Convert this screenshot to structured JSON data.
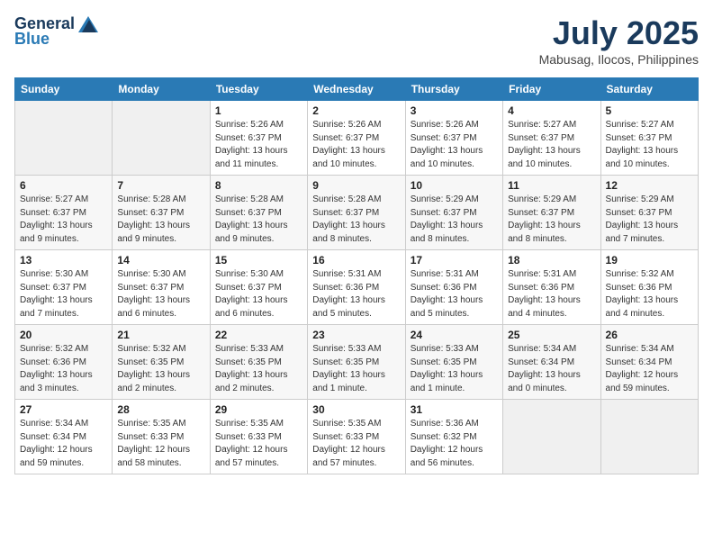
{
  "logo": {
    "general": "General",
    "blue": "Blue"
  },
  "title": {
    "month_year": "July 2025",
    "location": "Mabusag, Ilocos, Philippines"
  },
  "headers": [
    "Sunday",
    "Monday",
    "Tuesday",
    "Wednesday",
    "Thursday",
    "Friday",
    "Saturday"
  ],
  "weeks": [
    [
      {
        "day": "",
        "info": ""
      },
      {
        "day": "",
        "info": ""
      },
      {
        "day": "1",
        "info": "Sunrise: 5:26 AM\nSunset: 6:37 PM\nDaylight: 13 hours and 11 minutes."
      },
      {
        "day": "2",
        "info": "Sunrise: 5:26 AM\nSunset: 6:37 PM\nDaylight: 13 hours and 10 minutes."
      },
      {
        "day": "3",
        "info": "Sunrise: 5:26 AM\nSunset: 6:37 PM\nDaylight: 13 hours and 10 minutes."
      },
      {
        "day": "4",
        "info": "Sunrise: 5:27 AM\nSunset: 6:37 PM\nDaylight: 13 hours and 10 minutes."
      },
      {
        "day": "5",
        "info": "Sunrise: 5:27 AM\nSunset: 6:37 PM\nDaylight: 13 hours and 10 minutes."
      }
    ],
    [
      {
        "day": "6",
        "info": "Sunrise: 5:27 AM\nSunset: 6:37 PM\nDaylight: 13 hours and 9 minutes."
      },
      {
        "day": "7",
        "info": "Sunrise: 5:28 AM\nSunset: 6:37 PM\nDaylight: 13 hours and 9 minutes."
      },
      {
        "day": "8",
        "info": "Sunrise: 5:28 AM\nSunset: 6:37 PM\nDaylight: 13 hours and 9 minutes."
      },
      {
        "day": "9",
        "info": "Sunrise: 5:28 AM\nSunset: 6:37 PM\nDaylight: 13 hours and 8 minutes."
      },
      {
        "day": "10",
        "info": "Sunrise: 5:29 AM\nSunset: 6:37 PM\nDaylight: 13 hours and 8 minutes."
      },
      {
        "day": "11",
        "info": "Sunrise: 5:29 AM\nSunset: 6:37 PM\nDaylight: 13 hours and 8 minutes."
      },
      {
        "day": "12",
        "info": "Sunrise: 5:29 AM\nSunset: 6:37 PM\nDaylight: 13 hours and 7 minutes."
      }
    ],
    [
      {
        "day": "13",
        "info": "Sunrise: 5:30 AM\nSunset: 6:37 PM\nDaylight: 13 hours and 7 minutes."
      },
      {
        "day": "14",
        "info": "Sunrise: 5:30 AM\nSunset: 6:37 PM\nDaylight: 13 hours and 6 minutes."
      },
      {
        "day": "15",
        "info": "Sunrise: 5:30 AM\nSunset: 6:37 PM\nDaylight: 13 hours and 6 minutes."
      },
      {
        "day": "16",
        "info": "Sunrise: 5:31 AM\nSunset: 6:36 PM\nDaylight: 13 hours and 5 minutes."
      },
      {
        "day": "17",
        "info": "Sunrise: 5:31 AM\nSunset: 6:36 PM\nDaylight: 13 hours and 5 minutes."
      },
      {
        "day": "18",
        "info": "Sunrise: 5:31 AM\nSunset: 6:36 PM\nDaylight: 13 hours and 4 minutes."
      },
      {
        "day": "19",
        "info": "Sunrise: 5:32 AM\nSunset: 6:36 PM\nDaylight: 13 hours and 4 minutes."
      }
    ],
    [
      {
        "day": "20",
        "info": "Sunrise: 5:32 AM\nSunset: 6:36 PM\nDaylight: 13 hours and 3 minutes."
      },
      {
        "day": "21",
        "info": "Sunrise: 5:32 AM\nSunset: 6:35 PM\nDaylight: 13 hours and 2 minutes."
      },
      {
        "day": "22",
        "info": "Sunrise: 5:33 AM\nSunset: 6:35 PM\nDaylight: 13 hours and 2 minutes."
      },
      {
        "day": "23",
        "info": "Sunrise: 5:33 AM\nSunset: 6:35 PM\nDaylight: 13 hours and 1 minute."
      },
      {
        "day": "24",
        "info": "Sunrise: 5:33 AM\nSunset: 6:35 PM\nDaylight: 13 hours and 1 minute."
      },
      {
        "day": "25",
        "info": "Sunrise: 5:34 AM\nSunset: 6:34 PM\nDaylight: 13 hours and 0 minutes."
      },
      {
        "day": "26",
        "info": "Sunrise: 5:34 AM\nSunset: 6:34 PM\nDaylight: 12 hours and 59 minutes."
      }
    ],
    [
      {
        "day": "27",
        "info": "Sunrise: 5:34 AM\nSunset: 6:34 PM\nDaylight: 12 hours and 59 minutes."
      },
      {
        "day": "28",
        "info": "Sunrise: 5:35 AM\nSunset: 6:33 PM\nDaylight: 12 hours and 58 minutes."
      },
      {
        "day": "29",
        "info": "Sunrise: 5:35 AM\nSunset: 6:33 PM\nDaylight: 12 hours and 57 minutes."
      },
      {
        "day": "30",
        "info": "Sunrise: 5:35 AM\nSunset: 6:33 PM\nDaylight: 12 hours and 57 minutes."
      },
      {
        "day": "31",
        "info": "Sunrise: 5:36 AM\nSunset: 6:32 PM\nDaylight: 12 hours and 56 minutes."
      },
      {
        "day": "",
        "info": ""
      },
      {
        "day": "",
        "info": ""
      }
    ]
  ]
}
